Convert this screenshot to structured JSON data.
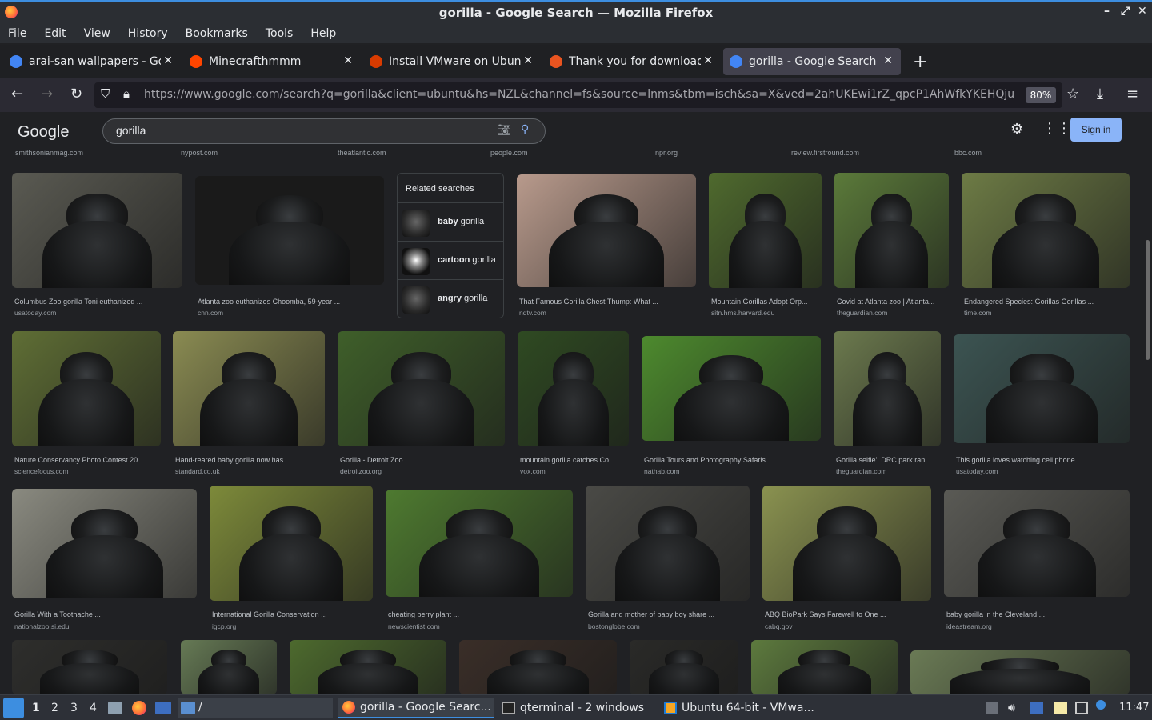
{
  "window": {
    "title": "gorilla - Google Search — Mozilla Firefox"
  },
  "menu": [
    "File",
    "Edit",
    "View",
    "History",
    "Bookmarks",
    "Tools",
    "Help"
  ],
  "tabs": [
    {
      "label": "arai-san wallpapers - Go",
      "favicon_color": "#4285f4",
      "active": false
    },
    {
      "label": "Minecrafthmmm",
      "favicon_color": "#ff4500",
      "active": false
    },
    {
      "label": "Install VMware on Ubuntu",
      "favicon_color": "#d83b01",
      "active": false
    },
    {
      "label": "Thank you for downloadi",
      "favicon_color": "#e95420",
      "active": false
    },
    {
      "label": "gorilla - Google Search",
      "favicon_color": "#4285f4",
      "active": true
    }
  ],
  "nav": {
    "url": "https://www.google.com/search?q=gorilla&client=ubuntu&hs=NZL&channel=fs&source=lnms&tbm=isch&sa=X&ved=2ahUKEwi1rZ_qpcP1AhWfkYKEHQju",
    "zoom": "80%"
  },
  "google": {
    "logo": "Google",
    "query": "gorilla",
    "sign_in": "Sign in"
  },
  "top_sources": [
    "smithsonianmag.com",
    "nypost.com",
    "theatlantic.com",
    "people.com",
    "npr.org",
    "review.firstround.com",
    "bbc.com"
  ],
  "related": {
    "heading": "Related searches",
    "items": [
      {
        "bold": "baby",
        "rest": " gorilla"
      },
      {
        "bold": "cartoon",
        "rest": " gorilla"
      },
      {
        "bold": "angry",
        "rest": " gorilla"
      }
    ]
  },
  "images": [
    {
      "caption": "Columbus Zoo gorilla Toni euthanized ...",
      "source": "usatoday.com",
      "bg": "#5a5a52"
    },
    {
      "caption": "Atlanta zoo euthanizes Choomba, 59-year ...",
      "source": "cnn.com",
      "bg": "#1a1a1a"
    },
    {
      "caption": "That Famous Gorilla Chest Thump: What ...",
      "source": "ndtv.com",
      "bg": "#b89a8c"
    },
    {
      "caption": "Mountain Gorillas Adopt Orp...",
      "source": "sitn.hms.harvard.edu",
      "bg": "#4f6a2e"
    },
    {
      "caption": "Covid at Atlanta zoo | Atlanta...",
      "source": "theguardian.com",
      "bg": "#5b7a3a"
    },
    {
      "caption": "Endangered Species: Gorillas Gorillas ...",
      "source": "time.com",
      "bg": "#6d7b45"
    },
    {
      "caption": "Nature Conservancy Photo Contest 20...",
      "source": "sciencefocus.com",
      "bg": "#5f6e35"
    },
    {
      "caption": "Hand-reared baby gorilla now has ...",
      "source": "standard.co.uk",
      "bg": "#8a8b52"
    },
    {
      "caption": "Gorilla - Detroit Zoo",
      "source": "detroitzoo.org",
      "bg": "#3f5f2a"
    },
    {
      "caption": "mountain gorilla catches Co...",
      "source": "vox.com",
      "bg": "#2f4a22"
    },
    {
      "caption": "Gorilla Tours and Photography Safaris ...",
      "source": "nathab.com",
      "bg": "#4d8a2e"
    },
    {
      "caption": "Gorilla selfie': DRC park ran...",
      "source": "theguardian.com",
      "bg": "#6c7a4e"
    },
    {
      "caption": "This gorilla loves watching cell phone ...",
      "source": "usatoday.com",
      "bg": "#3c5452"
    },
    {
      "caption": "Gorilla With a Toothache ...",
      "source": "nationalzoo.si.edu",
      "bg": "#8a8a80"
    },
    {
      "caption": "International Gorilla Conservation ...",
      "source": "igcp.org",
      "bg": "#7d8a3a"
    },
    {
      "caption": "cheating berry plant ...",
      "source": "newscientist.com",
      "bg": "#4e7a30"
    },
    {
      "caption": "Gorilla and mother of baby boy share ...",
      "source": "bostonglobe.com",
      "bg": "#4a4a46"
    },
    {
      "caption": "ABQ BioPark Says Farewell to One ...",
      "source": "cabq.gov",
      "bg": "#8a9250"
    },
    {
      "caption": "baby gorilla in the Cleveland ...",
      "source": "ideastream.org",
      "bg": "#5a5a55"
    },
    {
      "caption": "",
      "source": "",
      "bg": "#2e2e2c"
    },
    {
      "caption": "",
      "source": "",
      "bg": "#667a55"
    },
    {
      "caption": "",
      "source": "",
      "bg": "#4d6a2e"
    },
    {
      "caption": "",
      "source": "",
      "bg": "#3a2e28"
    },
    {
      "caption": "",
      "source": "",
      "bg": "#2a2a28"
    },
    {
      "caption": "",
      "source": "",
      "bg": "#5d7a3e"
    },
    {
      "caption": "",
      "source": "",
      "bg": "#6a7a55"
    }
  ],
  "taskbar": {
    "workspaces": [
      "1",
      "2",
      "3",
      "4"
    ],
    "path": "/",
    "tasks": [
      "gorilla - Google Searc...",
      "qterminal - 2 windows",
      "Ubuntu 64-bit - VMwa..."
    ],
    "clock": "11:47"
  }
}
